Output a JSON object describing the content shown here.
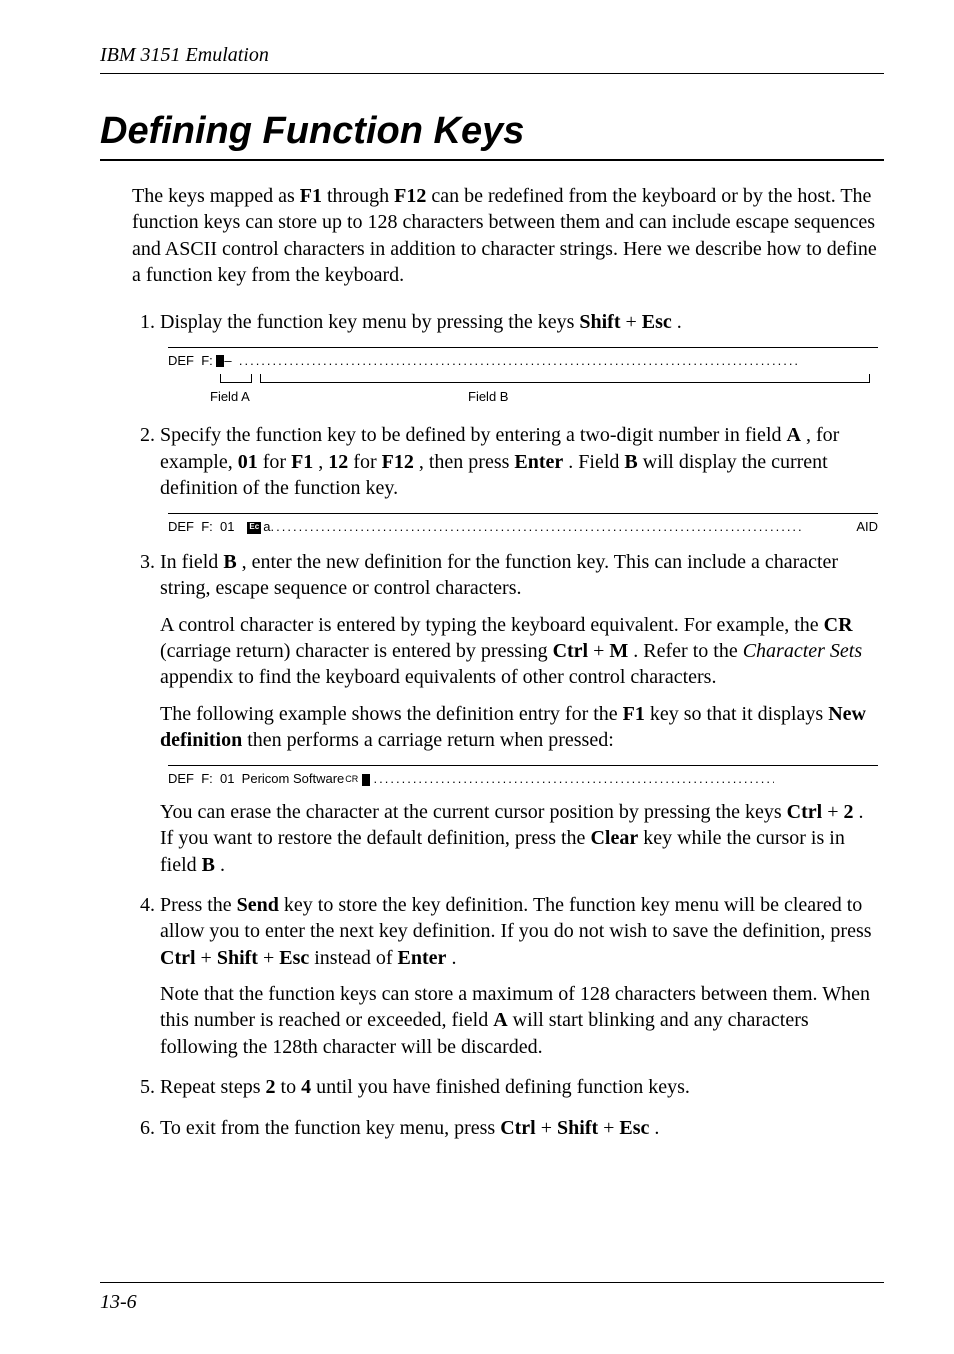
{
  "runningHead": "IBM 3151 Emulation",
  "title": "Defining Function Keys",
  "intro": {
    "t1": "The keys mapped as ",
    "b1": "F1",
    "t2": " through ",
    "b2": "F12",
    "t3": " can be redefined from the keyboard or by the host. The function keys can store up to 128 characters between them and can include escape sequences and ASCII control characters in addition to character strings. Here we describe how to define a function key from the keyboard."
  },
  "step1": {
    "t1": "Display the function key menu by pressing the keys ",
    "b1": "Shift",
    "t2": " + ",
    "b2": "Esc",
    "t3": "."
  },
  "fig1": {
    "prefix": "DEF  F: ",
    "dash": "–",
    "dots": "..............................................................................................................",
    "labelA": "Field A",
    "labelB": "Field B"
  },
  "step2": {
    "t1": "Specify the function key to be defined by entering a two-digit number in field ",
    "b1": "A",
    "t2": ", for example, ",
    "b2": "01",
    "t3": " for ",
    "b3": "F1",
    "t4": ", ",
    "b4": "12",
    "t5": " for ",
    "b5": "F12",
    "t6": ", then press ",
    "b6": "Enter",
    "t7": ". Field ",
    "b7": "B",
    "t8": " will display the current definition of the function key."
  },
  "fig2": {
    "prefix": "DEF  F:  01   ",
    "ec": "Ec",
    "afterEc": " a",
    "dots": "...................................................................................................",
    "aid": "AID"
  },
  "step3": {
    "p1": {
      "t1": "In field ",
      "b1": "B",
      "t2": ", enter the new definition for the function key. This can include a character string, escape sequence or control characters."
    },
    "p2": {
      "t1": "A control character is entered by typing the keyboard equivalent. For example, the ",
      "b1": "CR",
      "t2": " (carriage return) character is entered by pressing ",
      "b2": "Ctrl",
      "t3": " + ",
      "b3": "M",
      "t4": ". Refer to the ",
      "i1": "Character Sets",
      "t5": " appendix to find the keyboard equivalents of other control characters."
    },
    "p3": {
      "t1": "The following example shows the definition entry for the ",
      "b1": "F1",
      "t2": " key so that it displays ",
      "b2": "New definition",
      "t3": " then performs a carriage return when pressed:"
    },
    "p4": {
      "t1": "You can erase the character at the current cursor position by pressing the keys ",
      "b1": "Ctrl",
      "t2": " + ",
      "b2": "2",
      "t3": ". If you want to restore the default definition, press the ",
      "b3": "Clear",
      "t4": " key while the cursor is in field ",
      "b4": "B",
      "t5": "."
    }
  },
  "fig3": {
    "text": "DEF  F:  01  Pericom Software",
    "cr": "CR",
    "dots": "........................................................................................"
  },
  "step4": {
    "p1": {
      "t1": "Press the ",
      "b1": "Send",
      "t2": " key to store the key definition. The function key menu will be cleared to allow you to enter the next key definition. If you do not wish to save the definition, press ",
      "b2": "Ctrl",
      "t3": " + ",
      "b3": "Shift",
      "t4": " + ",
      "b4": "Esc",
      "t5": " instead of ",
      "b5": "Enter",
      "t6": "."
    },
    "p2": {
      "t1": "Note that the function keys can store a maximum of 128 characters between them. When this number is reached or exceeded, field ",
      "b1": "A",
      "t2": " will start blinking and any characters following the 128th character will be discarded."
    }
  },
  "step5": {
    "t1": "Repeat steps ",
    "b1": "2",
    "t2": " to ",
    "b2": "4",
    "t3": " until you have finished defining function keys."
  },
  "step6": {
    "t1": "To exit from the function key menu, press ",
    "b1": "Ctrl",
    "t2": " + ",
    "b2": "Shift",
    "t3": " + ",
    "b3": "Esc",
    "t4": "."
  },
  "footerNum": "13-6"
}
